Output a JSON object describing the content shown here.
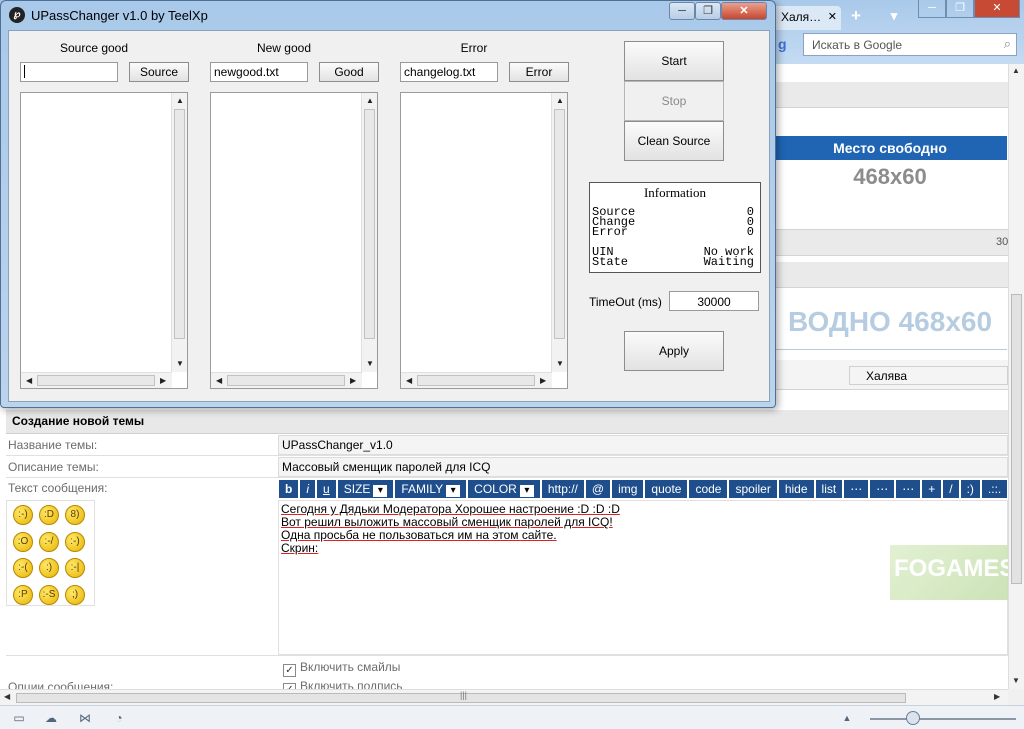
{
  "browser": {
    "active_tab": "Халя…",
    "search_placeholder": "Искать в Google"
  },
  "sidebar": {
    "ad_header": "Место свободно",
    "ad_size": "468x60",
    "side_number": "30",
    "banner_text": "ВОДНО 468x60",
    "field_value": "Халява"
  },
  "form": {
    "title": "Создание новой темы",
    "topic_name_label": "Название темы:",
    "topic_name_value": "UPassChanger_v1.0",
    "topic_desc_label": "Описание темы:",
    "topic_desc_value": "Массовый сменщик паролей для ICQ",
    "message_label": "Текст сообщения:",
    "bbcode_buttons": [
      "b",
      "i",
      "u",
      "SIZE",
      "FAMILY",
      "COLOR",
      "http://",
      "@",
      "img",
      "quote",
      "code",
      "spoiler",
      "hide",
      "list",
      "⋯",
      "⋯",
      "⋯",
      "+",
      "/",
      ":)",
      ".::."
    ],
    "message_lines": [
      "Сегодня у Дядьки Модератора Хорошее настроение :D :D :D",
      "Вот решил выложить массовый сменщик паролей для ICQ!",
      "Одна просьба не пользоваться им на этом сайте.",
      "Скрин:"
    ],
    "watermark": "FOGAMES",
    "options_label": "Опции сообщения:",
    "option_smiles": "Включить смайлы",
    "option_signature": "Включить подпись"
  },
  "app": {
    "title": "UPassChanger v1.0 by TeelXp",
    "icon_glyph": "℘",
    "source_good_label": "Source good",
    "source_good_value": "",
    "source_button": "Source",
    "new_good_label": "New good",
    "new_good_value": "newgood.txt",
    "good_button": "Good",
    "error_label": "Error",
    "error_value": "changelog.txt",
    "error_button": "Error",
    "start_button": "Start",
    "stop_button": "Stop",
    "clean_button": "Clean Source",
    "apply_button": "Apply",
    "info": {
      "title": "Information",
      "rows": [
        {
          "label": "Source",
          "value": "0"
        },
        {
          "label": "Change",
          "value": "0"
        },
        {
          "label": "Error",
          "value": "0"
        },
        {
          "label": "UIN",
          "value": "No work"
        },
        {
          "label": "State",
          "value": "Waiting"
        }
      ]
    },
    "timeout_label": "TimeOut (ms)",
    "timeout_value": "30000"
  },
  "icons": [
    "new-tab-icon",
    "bookmarks-icon",
    "minimize-icon",
    "maximize-icon",
    "close-icon",
    "search-icon",
    "smiley-icon",
    "checkbox-icon",
    "scroll-up-icon",
    "scroll-down-icon",
    "scroll-left-icon",
    "scroll-right-icon"
  ]
}
